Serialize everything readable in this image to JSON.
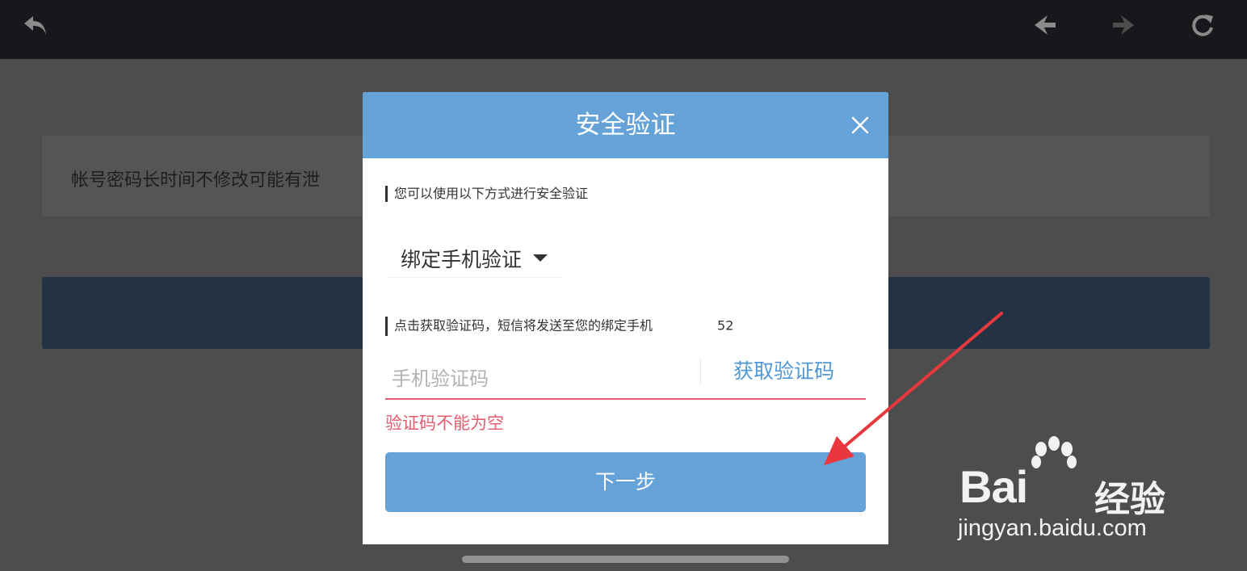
{
  "topbar": {
    "icons": [
      "back-arrow-icon",
      "nav-back-icon",
      "nav-forward-icon",
      "refresh-icon"
    ]
  },
  "background": {
    "notice_text": "帐号密码长时间不修改可能有泄"
  },
  "modal": {
    "title": "安全验证",
    "intro_label": "您可以使用以下方式进行安全验证",
    "method_selected": "绑定手机验证",
    "sms_label": "点击获取验证码，短信将发送至您的绑定手机",
    "sms_label_tail": "52",
    "code_placeholder": "手机验证码",
    "get_code_label": "获取验证码",
    "error_text": "验证码不能为空",
    "next_label": "下一步"
  },
  "watermark": {
    "logo_text": "Bai",
    "logo_text_2": "经验",
    "url": "jingyan.baidu.com"
  },
  "colors": {
    "header_blue": "#64a2d8",
    "link_blue": "#4f98d8",
    "error_red": "#e35d6f",
    "arrow_red": "#e8383d"
  }
}
